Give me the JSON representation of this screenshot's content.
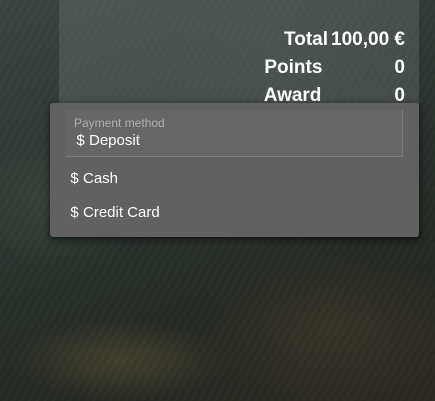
{
  "summary": {
    "total_label": "Total",
    "total_value": "100,00 €",
    "points_label": "Points",
    "points_value": "0",
    "award_label": "Award",
    "award_value": "0"
  },
  "payment": {
    "field_label": "Payment method",
    "selected_value": "Deposit",
    "options": [
      {
        "label": "Cash",
        "icon": "dollar-icon"
      },
      {
        "label": "Credit Card",
        "icon": "dollar-icon"
      }
    ]
  }
}
